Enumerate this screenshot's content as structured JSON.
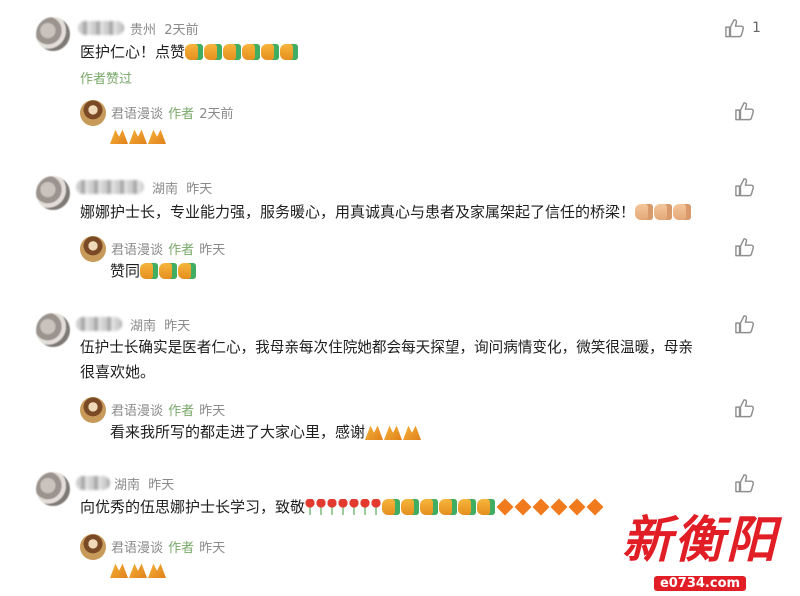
{
  "comments": [
    {
      "location": "贵州",
      "time": "2天前",
      "like_count": "1",
      "text": "医护仁心！点赞",
      "author_liked": "作者赞过",
      "reply": {
        "name": "君语漫谈",
        "tag": "作者",
        "time": "2天前",
        "text": ""
      }
    },
    {
      "location": "湖南",
      "time": "昨天",
      "text": "娜娜护士长，专业能力强，服务暖心，用真诚真心与患者及家属架起了信任的桥梁！",
      "reply": {
        "name": "君语漫谈",
        "tag": "作者",
        "time": "昨天",
        "text": "赞同"
      }
    },
    {
      "location": "湖南",
      "time": "昨天",
      "text_line1": "伍护士长确实是医者仁心，我母亲每次住院她都会每天探望，询问病情变化，微笑很温暖，母亲",
      "text_line2": "很喜欢她。",
      "reply": {
        "name": "君语漫谈",
        "tag": "作者",
        "time": "昨天",
        "text": "看来我所写的都走进了大家心里，感谢"
      }
    },
    {
      "location": "湖南",
      "time": "昨天",
      "text": "向优秀的伍思娜护士长学习，致敬",
      "reply": {
        "name": "君语漫谈",
        "tag": "作者",
        "time": "昨天",
        "text": ""
      }
    }
  ],
  "watermark": {
    "title": "新衡阳",
    "url": "e0734.com"
  },
  "icons": {
    "like": "thumbs-up-outline-icon",
    "emoji_thumb": "thumbs-up-emoji",
    "emoji_pray": "pray-emoji",
    "emoji_rose": "rose-emoji",
    "emoji_diamond": "orange-diamond-emoji"
  },
  "colors": {
    "author_tag": "#79a86a",
    "meta": "#8a8a8a",
    "text": "#1e1e1e",
    "logo_red": "#e11e26"
  }
}
